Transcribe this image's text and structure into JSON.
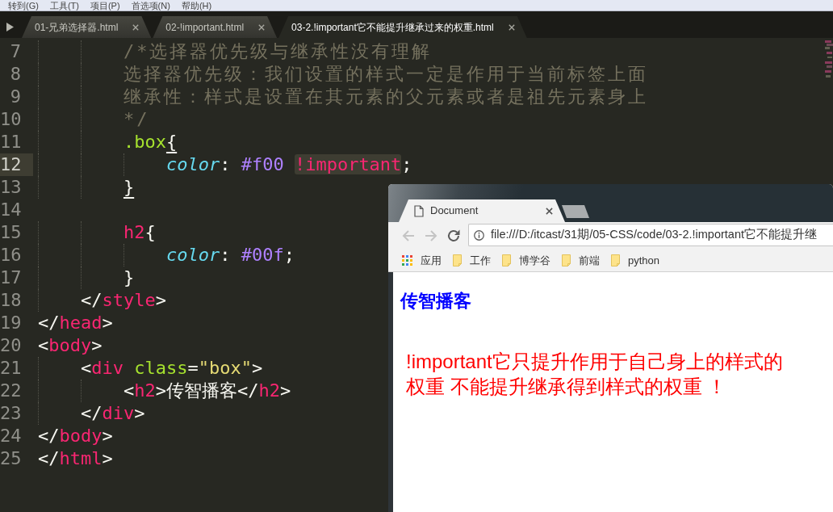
{
  "menu_bar": {
    "items": [
      "转到(G)",
      "工具(T)",
      "项目(P)",
      "首选项(N)",
      "帮助(H)"
    ]
  },
  "editor_tabs": [
    {
      "label": "01-兄弟选择器.html",
      "selected": false
    },
    {
      "label": "02-!important.html",
      "selected": false
    },
    {
      "label": "03-2.!important它不能提升继承过来的权重.html",
      "selected": true
    }
  ],
  "code": {
    "lines": [
      {
        "number": "7",
        "current": false,
        "tokens": [
          {
            "kind": "comment",
            "text": "        /*选择器优先级与继承性没有理解"
          }
        ]
      },
      {
        "number": "8",
        "current": false,
        "tokens": [
          {
            "kind": "comment",
            "text": "        选择器优先级：我们设置的样式一定是作用于当前标签上面"
          }
        ]
      },
      {
        "number": "9",
        "current": false,
        "tokens": [
          {
            "kind": "comment",
            "text": "        继承性：样式是设置在其元素的父元素或者是祖先元素身上"
          }
        ]
      },
      {
        "number": "10",
        "current": false,
        "tokens": [
          {
            "kind": "comment",
            "text": "        */"
          }
        ]
      },
      {
        "number": "11",
        "current": false,
        "tokens": [
          {
            "kind": "selector",
            "text": "        .box"
          },
          {
            "kind": "bracket_match",
            "text": "{"
          }
        ]
      },
      {
        "number": "12",
        "current": true,
        "tokens": [
          {
            "kind": "property",
            "text": "            color"
          },
          {
            "kind": "punct",
            "text": ": "
          },
          {
            "kind": "value",
            "text": "#f00 "
          },
          {
            "kind": "highlight",
            "text": "!important"
          },
          {
            "kind": "punct",
            "text": ";"
          }
        ]
      },
      {
        "number": "13",
        "current": false,
        "tokens": [
          {
            "kind": "bracket_match",
            "text": "        }"
          }
        ]
      },
      {
        "number": "14",
        "current": false
      },
      {
        "number": "15",
        "current": false,
        "tokens": [
          {
            "kind": "tag",
            "text": "        h2"
          },
          {
            "kind": "punct",
            "text": "{"
          }
        ]
      },
      {
        "number": "16",
        "current": false,
        "tokens": [
          {
            "kind": "property",
            "text": "            color"
          },
          {
            "kind": "punct",
            "text": ": "
          },
          {
            "kind": "value",
            "text": "#00f"
          },
          {
            "kind": "punct",
            "text": ";"
          }
        ]
      },
      {
        "number": "17",
        "current": false,
        "tokens": [
          {
            "kind": "punct",
            "text": "        }"
          }
        ]
      },
      {
        "number": "18",
        "current": false,
        "tokens": [
          {
            "kind": "punct",
            "text": "    </"
          },
          {
            "kind": "tag",
            "text": "style"
          },
          {
            "kind": "punct",
            "text": ">"
          }
        ]
      },
      {
        "number": "19",
        "current": false,
        "tokens": [
          {
            "kind": "punct",
            "text": "</"
          },
          {
            "kind": "tag",
            "text": "head"
          },
          {
            "kind": "punct",
            "text": ">"
          }
        ]
      },
      {
        "number": "20",
        "current": false,
        "tokens": [
          {
            "kind": "punct",
            "text": "<"
          },
          {
            "kind": "tag",
            "text": "body"
          },
          {
            "kind": "punct",
            "text": ">"
          }
        ]
      },
      {
        "number": "21",
        "current": false,
        "tokens": [
          {
            "kind": "punct",
            "text": "    <"
          },
          {
            "kind": "tag",
            "text": "div "
          },
          {
            "kind": "attr",
            "text": "class"
          },
          {
            "kind": "punct",
            "text": "="
          },
          {
            "kind": "string",
            "text": "\"box\""
          },
          {
            "kind": "punct",
            "text": ">"
          }
        ]
      },
      {
        "number": "22",
        "current": false,
        "tokens": [
          {
            "kind": "punct",
            "text": "        <"
          },
          {
            "kind": "tag",
            "text": "h2"
          },
          {
            "kind": "punct",
            "text": ">传智播客</"
          },
          {
            "kind": "tag",
            "text": "h2"
          },
          {
            "kind": "punct",
            "text": ">"
          }
        ]
      },
      {
        "number": "23",
        "current": false,
        "tokens": [
          {
            "kind": "punct",
            "text": "    </"
          },
          {
            "kind": "tag",
            "text": "div"
          },
          {
            "kind": "punct",
            "text": ">"
          }
        ]
      },
      {
        "number": "24",
        "current": false,
        "tokens": [
          {
            "kind": "punct",
            "text": "</"
          },
          {
            "kind": "tag",
            "text": "body"
          },
          {
            "kind": "punct",
            "text": ">"
          }
        ]
      },
      {
        "number": "25",
        "current": false,
        "tokens": [
          {
            "kind": "punct",
            "text": "</"
          },
          {
            "kind": "tag",
            "text": "html"
          },
          {
            "kind": "punct",
            "text": ">"
          }
        ]
      }
    ]
  },
  "browser": {
    "tab": {
      "title": "Document"
    },
    "address": "file:///D:/itcast/31期/05-CSS/code/03-2.!important它不能提升继",
    "bookmarks": [
      {
        "kind": "apps",
        "label": "应用"
      },
      {
        "kind": "folder",
        "label": "工作"
      },
      {
        "kind": "folder",
        "label": "博学谷"
      },
      {
        "kind": "folder",
        "label": "前端"
      },
      {
        "kind": "folder",
        "label": "python"
      }
    ],
    "page": {
      "heading": "传智播客",
      "paragraph": "!important它只提升作用于自己身上的样式的权重 不能提升继承得到样式的权重 ！"
    }
  }
}
